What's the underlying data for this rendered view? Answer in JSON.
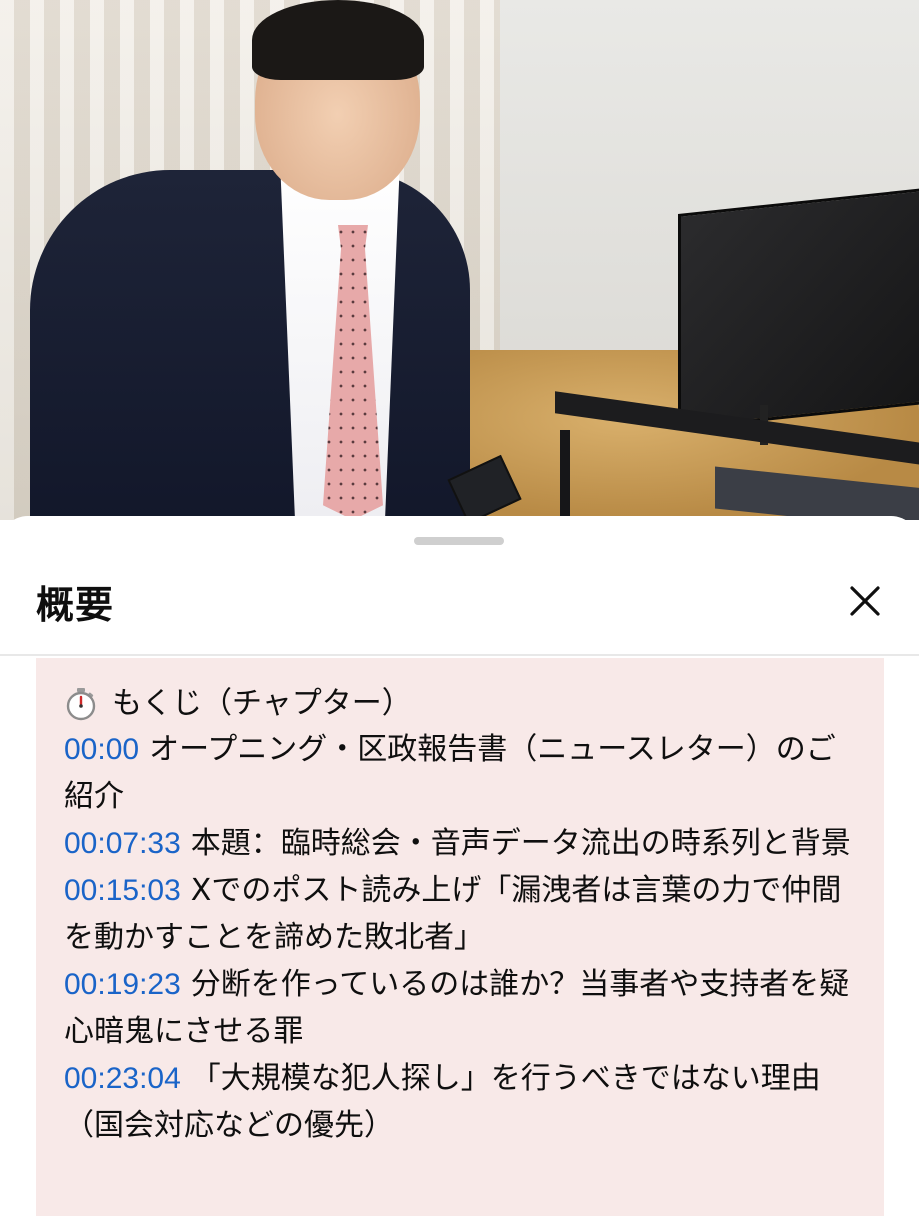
{
  "sheet": {
    "title": "概要",
    "close_icon": "close-icon"
  },
  "description": {
    "toc_icon": "stopwatch-icon",
    "toc_heading": "もくじ（チャプター）",
    "chapters": [
      {
        "time": "00:00",
        "title": "オープニング・区政報告書（ニュースレター）のご紹介"
      },
      {
        "time": "00:07:33",
        "title": "本題：臨時総会・音声データ流出の時系列と背景"
      },
      {
        "time": "00:15:03",
        "title": "Xでのポスト読み上げ「漏洩者は言葉の力で仲間を動かすことを諦めた敗北者」"
      },
      {
        "time": "00:19:23",
        "title": "分断を作っているのは誰か？当事者や支持者を疑心暗鬼にさせる罪"
      },
      {
        "time": "00:23:04",
        "title": "「大規模な犯人探し」を行うべきではない理由（国会対応などの優先）"
      }
    ]
  },
  "colors": {
    "timestamp": "#1a64c8",
    "card_bg": "#f8e9e8"
  }
}
